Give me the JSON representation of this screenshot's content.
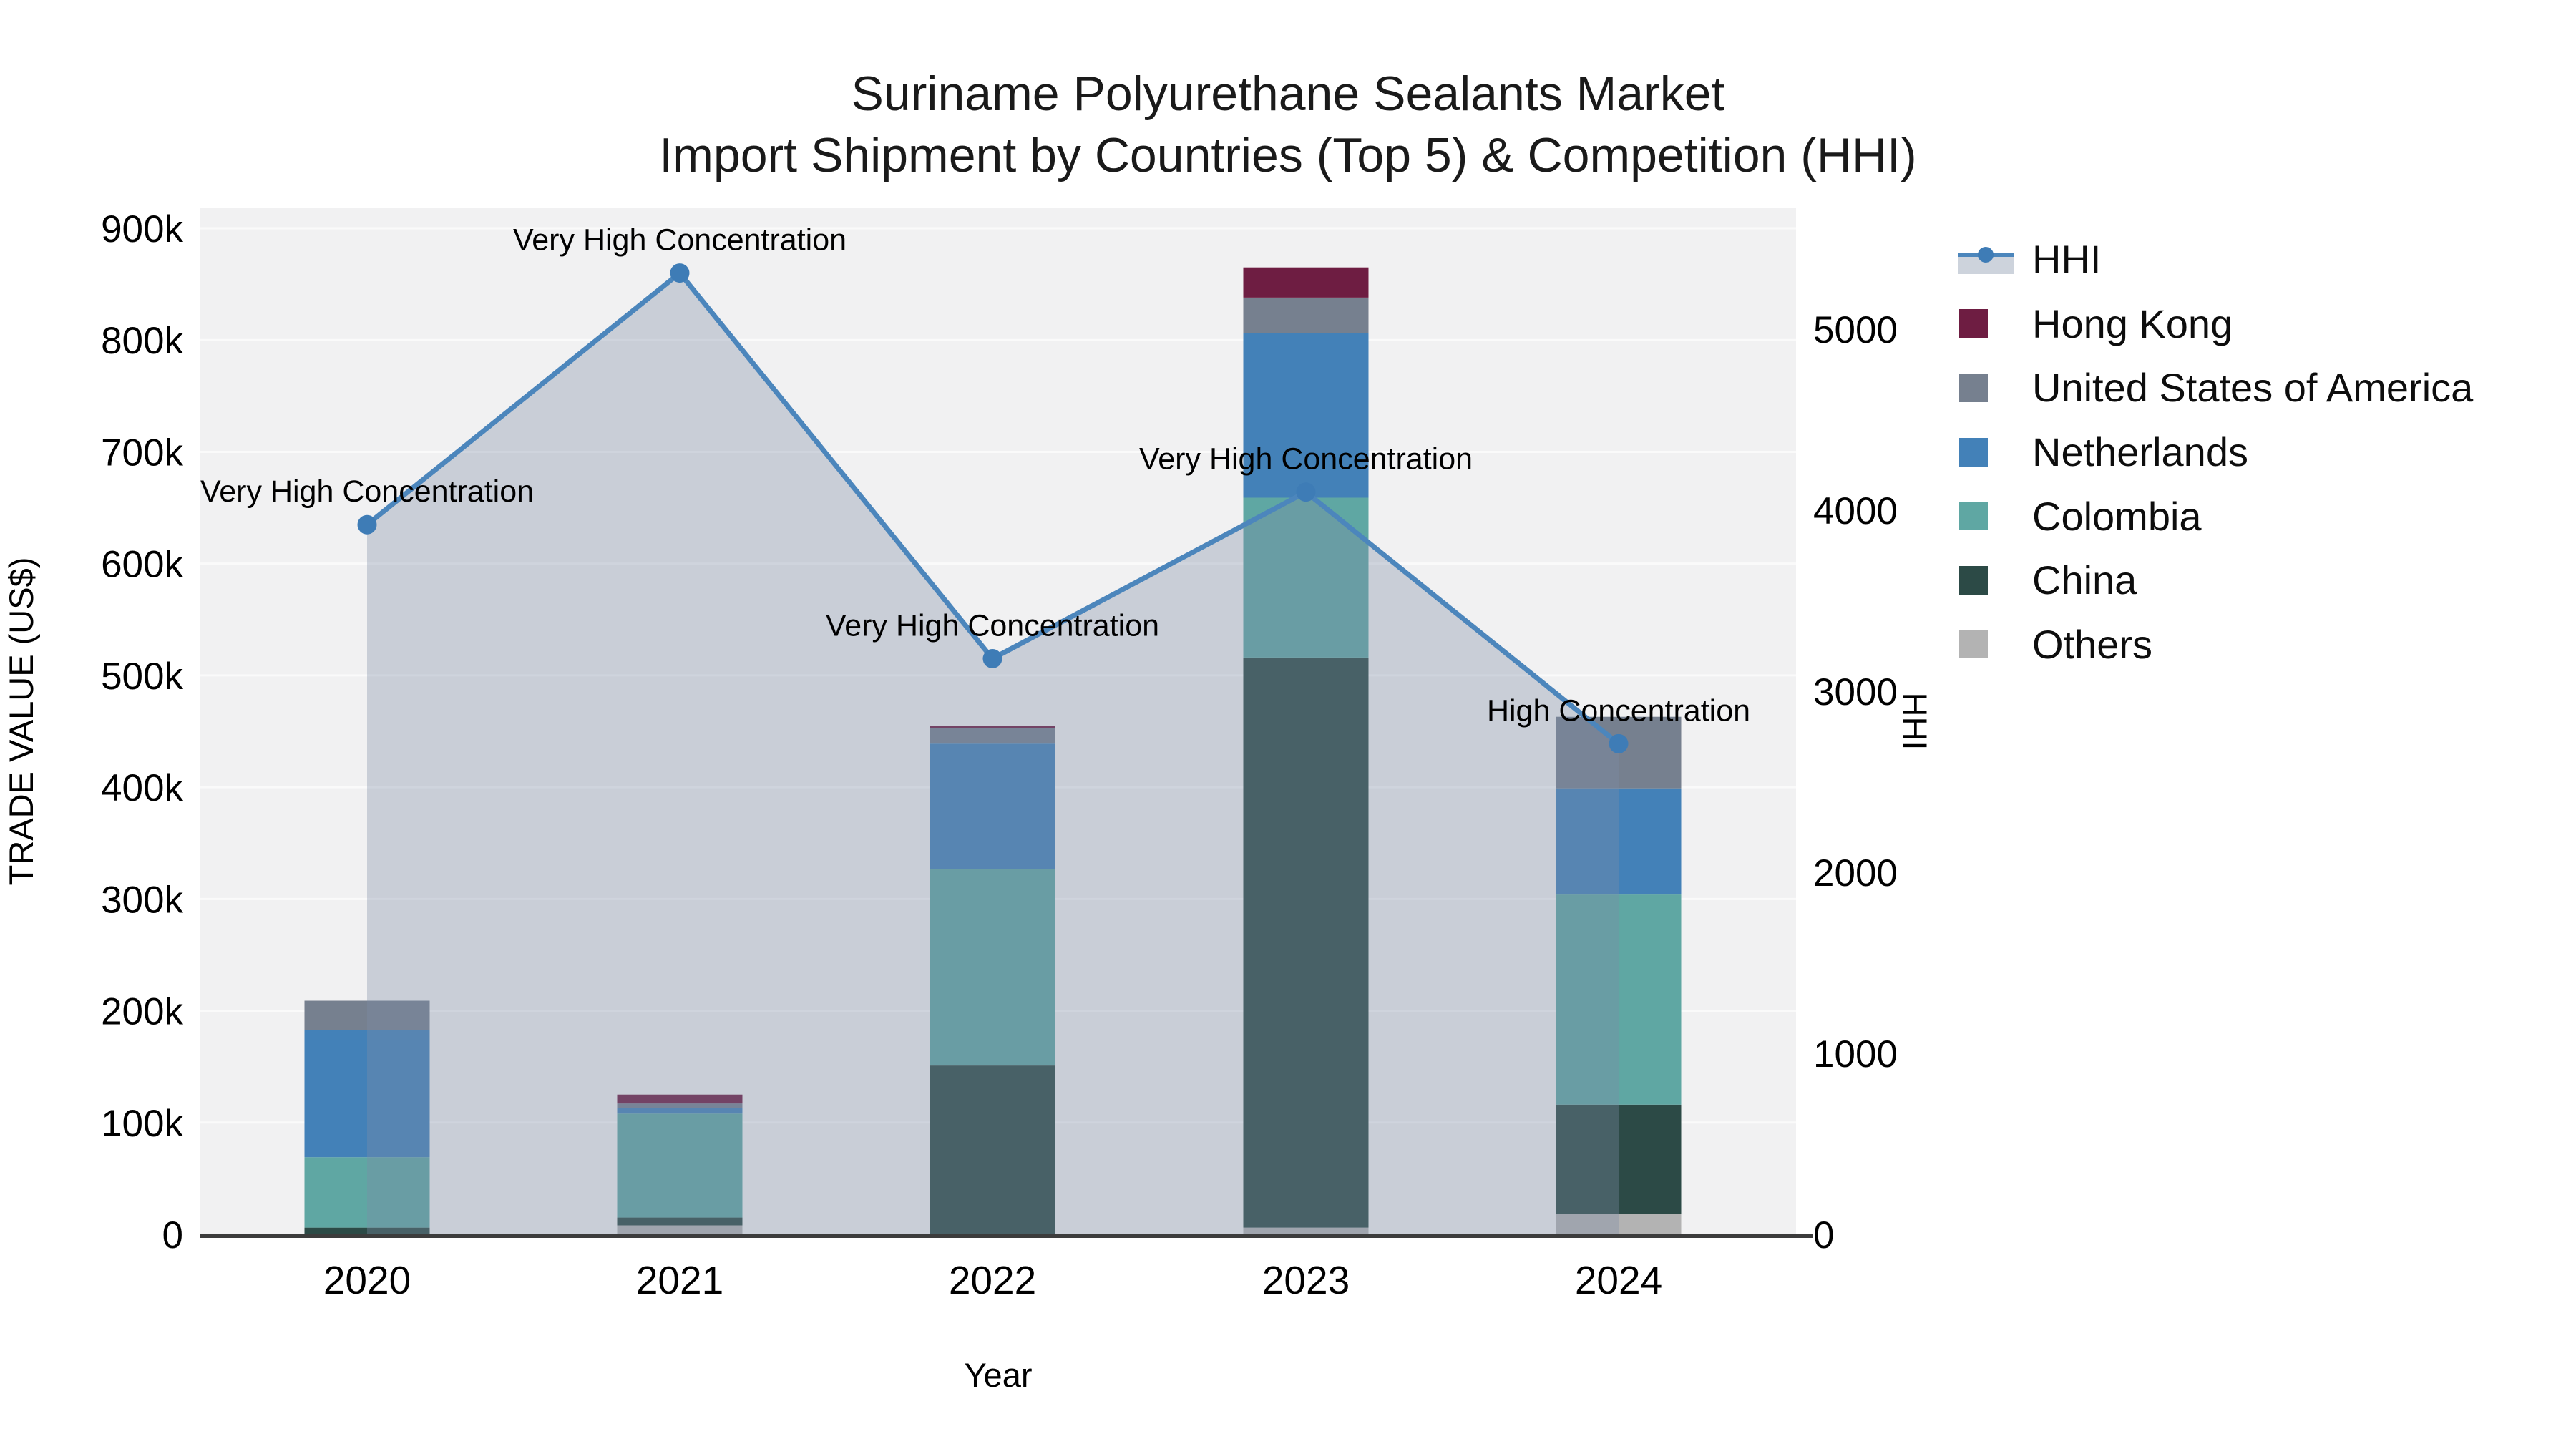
{
  "title": {
    "line1": "Suriname Polyurethane Sealants Market",
    "line2": "Import Shipment by Countries (Top 5) & Competition (HHI)"
  },
  "axes": {
    "x_title": "Year",
    "left_title": "TRADE VALUE (US$)",
    "right_title": "HHI",
    "left_tick_labels": [
      "0",
      "100k",
      "200k",
      "300k",
      "400k",
      "500k",
      "600k",
      "700k",
      "800k",
      "900k"
    ],
    "left_tick_values_k": [
      0,
      100,
      200,
      300,
      400,
      500,
      600,
      700,
      800,
      900
    ],
    "right_tick_labels": [
      "0",
      "1000",
      "2000",
      "3000",
      "4000",
      "5000"
    ],
    "right_tick_values": [
      0,
      1000,
      2000,
      3000,
      4000,
      5000
    ]
  },
  "legend": {
    "items": [
      {
        "label": "HHI",
        "key": "hhi"
      },
      {
        "label": "Hong Kong",
        "key": "hong_kong"
      },
      {
        "label": "United States of America",
        "key": "usa"
      },
      {
        "label": "Netherlands",
        "key": "netherlands"
      },
      {
        "label": "Colombia",
        "key": "colombia"
      },
      {
        "label": "China",
        "key": "china"
      },
      {
        "label": "Others",
        "key": "others"
      }
    ],
    "position": "right"
  },
  "colors": {
    "hhi_line": "#4C86BC",
    "hhi_marker": "#3E7CB6",
    "hhi_fill": "#7D8BA5",
    "hhi_fill_opacity": 0.35,
    "hong_kong": "#6E1D42",
    "usa": "#76808F",
    "netherlands": "#4381B8",
    "colombia": "#5FA7A3",
    "china": "#2C4A46",
    "others": "#B3B3B3",
    "plot_bg": "#F1F1F2",
    "gridline": "#FAFAFA",
    "spine": "#3C3C3C",
    "text": "#000000"
  },
  "chart_data": {
    "type": "combo: stacked-bar (left axis) + line with markers and shaded area (right axis)",
    "title": "Suriname Polyurethane Sealants Market — Import Shipment by Countries (Top 5) & Competition (HHI)",
    "categories": [
      "2020",
      "2021",
      "2022",
      "2023",
      "2024"
    ],
    "values_unit": "thousand US$ (trade value); index points (HHI)",
    "stack_order_bottom_to_top": [
      "Others",
      "China",
      "Colombia",
      "Netherlands",
      "United States of America",
      "Hong Kong"
    ],
    "series": [
      {
        "name": "Hong Kong",
        "color_key": "hong_kong",
        "values": [
          0,
          8,
          2,
          27,
          0
        ]
      },
      {
        "name": "United States of America",
        "color_key": "usa",
        "values": [
          26,
          4,
          14,
          32,
          64
        ]
      },
      {
        "name": "Netherlands",
        "color_key": "netherlands",
        "values": [
          114,
          5,
          112,
          147,
          95
        ]
      },
      {
        "name": "Colombia",
        "color_key": "colombia",
        "values": [
          63,
          93,
          176,
          143,
          188
        ]
      },
      {
        "name": "China",
        "color_key": "china",
        "values": [
          6,
          7,
          151,
          510,
          98
        ]
      },
      {
        "name": "Others",
        "color_key": "others",
        "values": [
          0,
          8,
          0,
          6,
          18
        ]
      }
    ],
    "bar_totals_k": [
      209,
      125,
      455,
      865,
      463
    ],
    "line_series": {
      "name": "HHI",
      "axis": "right",
      "values": [
        3920,
        5310,
        3180,
        4100,
        2710
      ]
    },
    "annotations": [
      {
        "category": "2020",
        "text": "Very High Concentration"
      },
      {
        "category": "2021",
        "text": "Very High Concentration"
      },
      {
        "category": "2022",
        "text": "Very High Concentration"
      },
      {
        "category": "2023",
        "text": "Very High Concentration"
      },
      {
        "category": "2024",
        "text": "High Concentration"
      }
    ],
    "left_axis": {
      "title": "TRADE VALUE (US$)",
      "range": [
        0,
        900000
      ],
      "tick_step": 100000
    },
    "right_axis": {
      "title": "HHI",
      "range": [
        0,
        5600
      ],
      "tick_step": 1000
    },
    "grid": "horizontal gridlines only, light on gray panel",
    "legend_position": "right outside plot"
  }
}
